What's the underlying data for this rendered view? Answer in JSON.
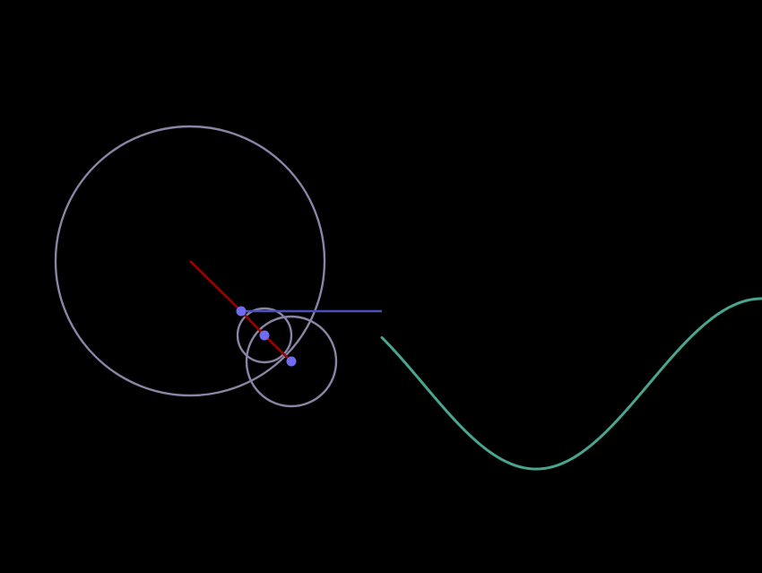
{
  "colors": {
    "background": "#000000",
    "circle_stroke": "#8a85a6",
    "radius_arm": "#a00000",
    "joint_dot": "#6f6cf2",
    "connector": "#4b4fb8",
    "wave": "#4aa58f"
  },
  "icons": {
    "joint": "joint-dot-icon"
  }
}
